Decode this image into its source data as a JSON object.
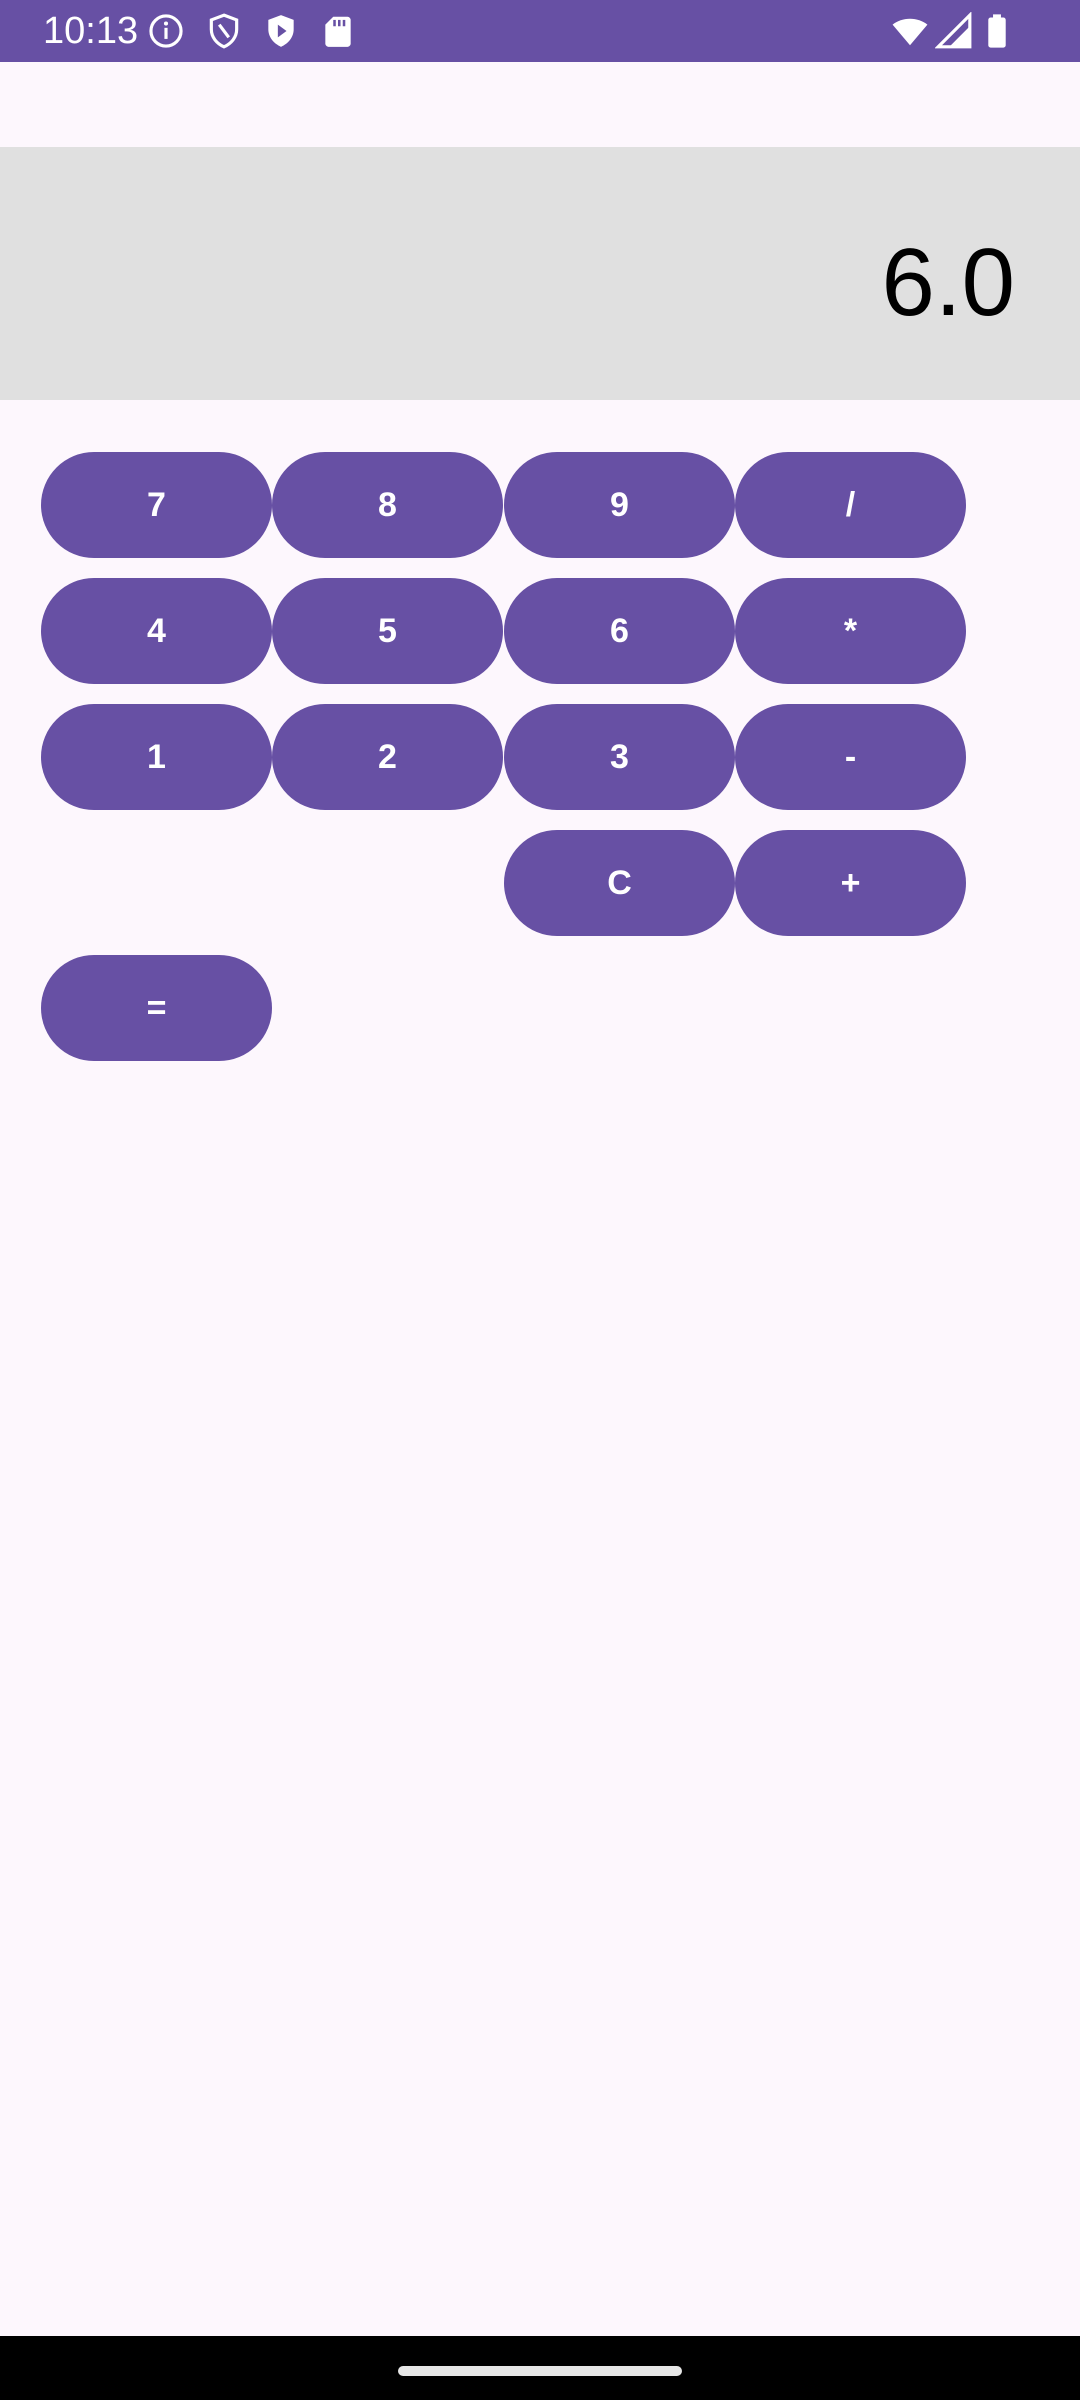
{
  "status_bar": {
    "time": "10:13",
    "icons_left": [
      "info-icon",
      "shield-icon",
      "play-protect-icon",
      "sd-card-icon"
    ],
    "icons_right": [
      "wifi-icon",
      "signal-icon",
      "battery-icon"
    ],
    "color": "#6750A4"
  },
  "display": {
    "value": "6.0",
    "background": "#E0E0E0"
  },
  "keypad": {
    "row1": [
      "7",
      "8",
      "9",
      "/"
    ],
    "row2": [
      "4",
      "5",
      "6",
      "*"
    ],
    "row3": [
      "1",
      "2",
      "3",
      "-"
    ],
    "row4": [
      "C",
      "+"
    ],
    "row5": [
      "="
    ],
    "button_color": "#6750A4",
    "text_color": "#FFFFFF"
  },
  "theme": {
    "background": "#FDF7FD"
  }
}
